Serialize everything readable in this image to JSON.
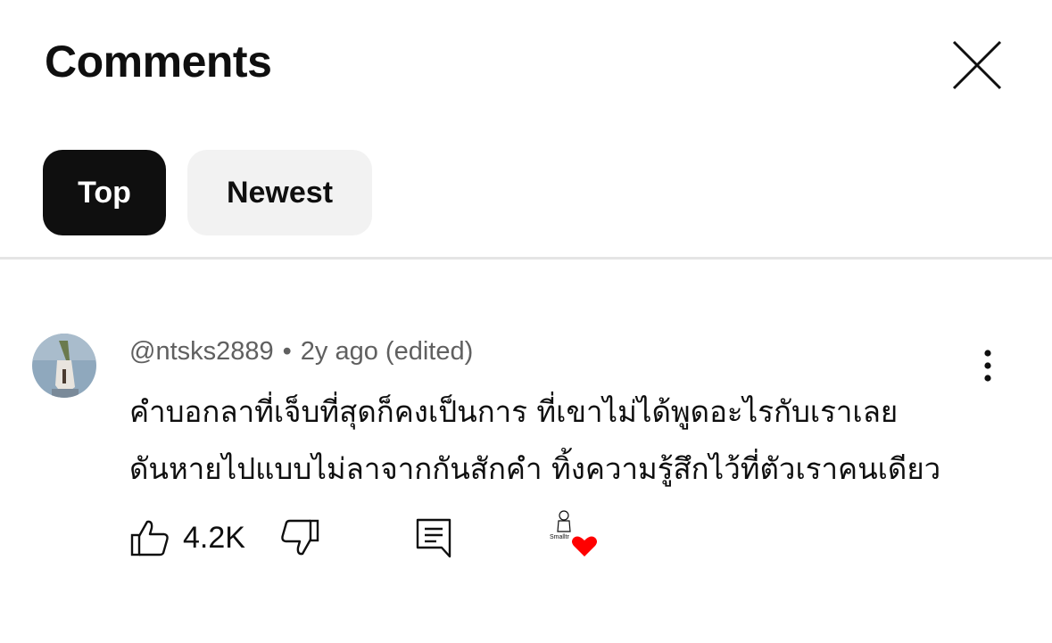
{
  "header": {
    "title": "Comments"
  },
  "filters": {
    "top_label": "Top",
    "newest_label": "Newest"
  },
  "comment": {
    "author": "@ntsks2889",
    "separator": "•",
    "age": "2y ago (edited)",
    "text_line1": "คำบอกลาที่เจ็บที่สุดก็คงเป็นการ ที่เขาไม่ได้พูดอะไรกับเราเลย",
    "text_line2": "ดันหายไปแบบไม่ลาจากกันสักคำ ทิ้งความรู้สึกไว้ที่ตัวเราคนเดียว",
    "like_count": "4.2K",
    "creator_badge_label": "Smalltr"
  },
  "icons": {
    "close": "close-icon",
    "more": "more-vertical-icon",
    "like": "thumbs-up-icon",
    "dislike": "thumbs-down-icon",
    "reply": "comment-icon",
    "heart": "heart-icon"
  },
  "colors": {
    "heart": "#ff0000",
    "chip_active": "#0f0f0f",
    "chip_inactive": "#f2f2f2",
    "meta_text": "#606060"
  }
}
